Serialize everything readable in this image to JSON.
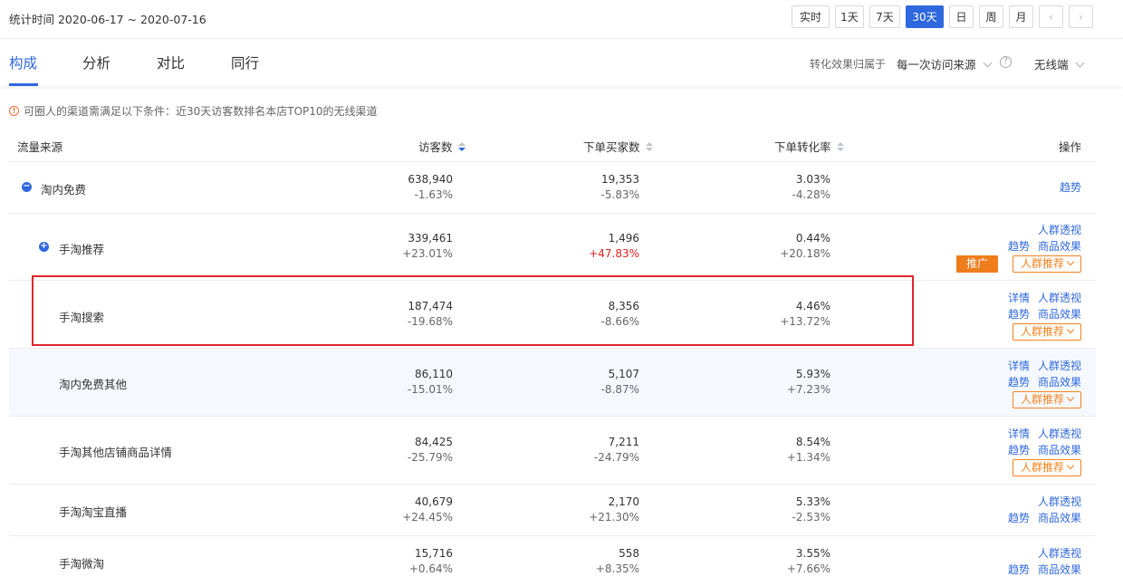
{
  "stat_date": "统计时间 2020-06-17 ~ 2020-07-16",
  "range_buttons": [
    "实时",
    "1天",
    "7天",
    "30天",
    "日",
    "周",
    "月"
  ],
  "range_active": "30天",
  "nav": {
    "prev": "‹",
    "next": "›"
  },
  "tabs": [
    "构成",
    "分析",
    "对比",
    "同行"
  ],
  "active_tab": "构成",
  "attribution_label": "转化效果归属于",
  "attribution_value": "每一次访问来源",
  "help": "?",
  "device_value": "无线端",
  "notice_icon": "!",
  "notice": "可圈人的渠道需满足以下条件：近30天访客数排名本店TOP10的无线渠道",
  "columns": {
    "source": "流量来源",
    "visitors": "访客数",
    "buyers": "下单买家数",
    "conversion": "下单转化率",
    "ops": "操作"
  },
  "promo_label": "推广",
  "rows": [
    {
      "source": "淘内免费",
      "expand": "−",
      "visitors": "638,940",
      "visitors_change": "-1.63%",
      "buyers": "19,353",
      "buyers_change": "-5.83%",
      "conversion": "3.03%",
      "conversion_change": "-4.28%",
      "ops": {
        "trend": "趋势"
      }
    },
    {
      "source": "手淘推荐",
      "expand": "+",
      "visitors": "339,461",
      "visitors_change": "+23.01%",
      "buyers": "1,496",
      "buyers_change": "+47.83%",
      "conversion": "0.44%",
      "conversion_change": "+20.18%",
      "ops": {
        "crowd": "人群透视",
        "trend": "趋势",
        "goods": "商品效果",
        "recommend": "人群推荐"
      }
    },
    {
      "source": "手淘搜索",
      "visitors": "187,474",
      "visitors_change": "-19.68%",
      "buyers": "8,356",
      "buyers_change": "-8.66%",
      "conversion": "4.46%",
      "conversion_change": "+13.72%",
      "ops": {
        "detail": "详情",
        "crowd": "人群透视",
        "trend": "趋势",
        "goods": "商品效果",
        "recommend": "人群推荐"
      }
    },
    {
      "source": "淘内免费其他",
      "visitors": "86,110",
      "visitors_change": "-15.01%",
      "buyers": "5,107",
      "buyers_change": "-8.87%",
      "conversion": "5.93%",
      "conversion_change": "+7.23%",
      "ops": {
        "detail": "详情",
        "crowd": "人群透视",
        "trend": "趋势",
        "goods": "商品效果",
        "recommend": "人群推荐"
      }
    },
    {
      "source": "手淘其他店铺商品详情",
      "visitors": "84,425",
      "visitors_change": "-25.79%",
      "buyers": "7,211",
      "buyers_change": "-24.79%",
      "conversion": "8.54%",
      "conversion_change": "+1.34%",
      "ops": {
        "detail": "详情",
        "crowd": "人群透视",
        "trend": "趋势",
        "goods": "商品效果",
        "recommend": "人群推荐"
      }
    },
    {
      "source": "手淘淘宝直播",
      "visitors": "40,679",
      "visitors_change": "+24.45%",
      "buyers": "2,170",
      "buyers_change": "+21.30%",
      "conversion": "5.33%",
      "conversion_change": "-2.53%",
      "ops": {
        "crowd": "人群透视",
        "trend": "趋势",
        "goods": "商品效果"
      }
    },
    {
      "source": "手淘微淘",
      "visitors": "15,716",
      "visitors_change": "+0.64%",
      "buyers": "558",
      "buyers_change": "+8.35%",
      "conversion": "3.55%",
      "conversion_change": "+7.66%",
      "ops": {
        "crowd": "人群透视",
        "trend": "趋势",
        "goods": "商品效果"
      }
    }
  ],
  "colors": {
    "accent": "#2f68dd",
    "highlight_box": "#e0262a",
    "promo": "#f07d1c",
    "negative_red": "#e02020"
  }
}
